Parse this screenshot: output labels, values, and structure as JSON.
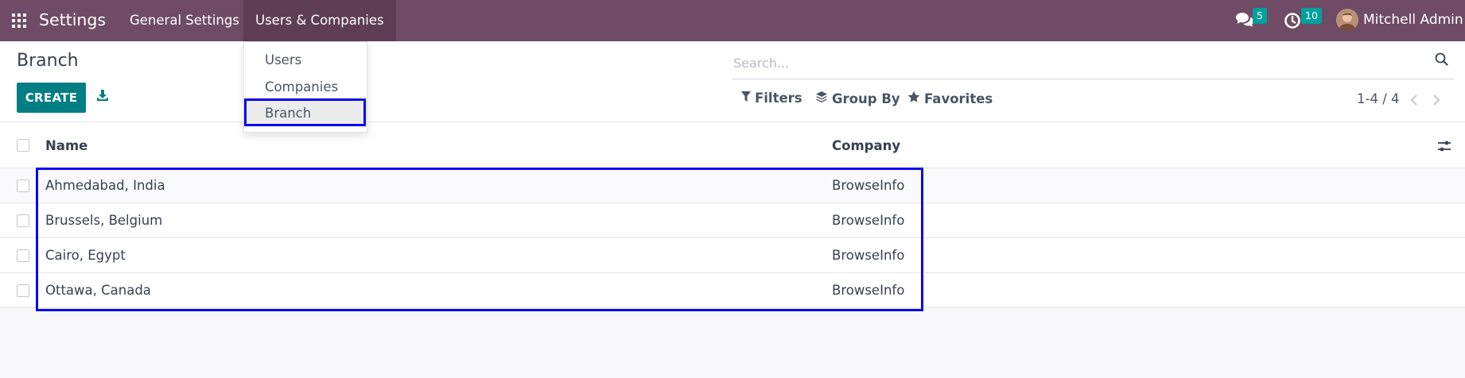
{
  "navbar": {
    "app_title": "Settings",
    "menus": [
      "General Settings",
      "Users & Companies"
    ],
    "messages_badge": "5",
    "activities_badge": "10",
    "user_name": "Mitchell Admin"
  },
  "dropdown": {
    "items": [
      "Users",
      "Companies",
      "Branch"
    ],
    "active_item": "Branch"
  },
  "control_panel": {
    "title": "Branch",
    "create_label": "CREATE",
    "search_placeholder": "Search...",
    "filters_label": "Filters",
    "group_by_label": "Group By",
    "favorites_label": "Favorites",
    "pager": "1-4 / 4"
  },
  "list": {
    "columns": [
      "Name",
      "Company"
    ],
    "rows": [
      {
        "name": "Ahmedabad, India",
        "company": "BrowseInfo"
      },
      {
        "name": "Brussels, Belgium",
        "company": "BrowseInfo"
      },
      {
        "name": "Cairo, Egypt",
        "company": "BrowseInfo"
      },
      {
        "name": "Ottawa, Canada",
        "company": "BrowseInfo"
      }
    ]
  },
  "colors": {
    "navbar": "#6f4b65",
    "primary": "#017e84",
    "badge": "#00a09d",
    "highlight": "#0a05f0"
  },
  "icons": {
    "apps": "grid-icon",
    "messages": "chat-icon",
    "activities": "clock-icon",
    "download": "download-icon",
    "search": "search-icon",
    "filters": "funnel-icon",
    "group_by": "layers-icon",
    "favorites": "star-icon",
    "pager_prev": "chevron-left-icon",
    "pager_next": "chevron-right-icon",
    "optional_columns": "sliders-icon"
  }
}
